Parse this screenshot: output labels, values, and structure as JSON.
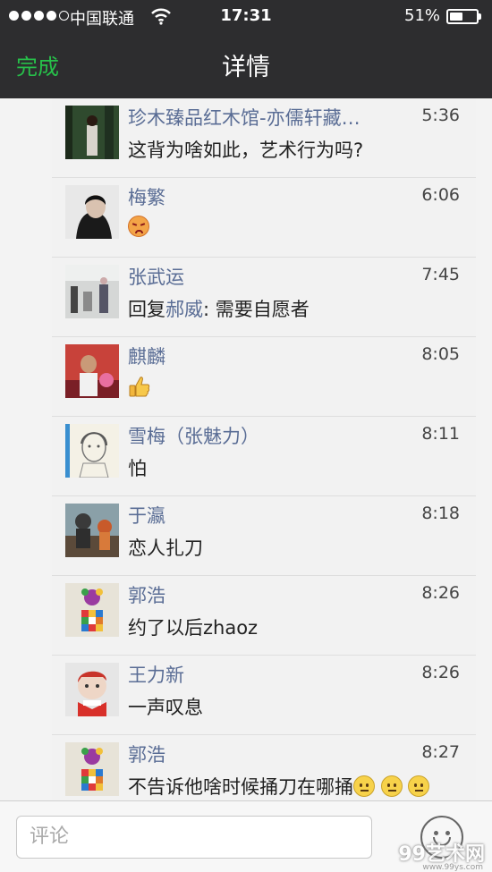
{
  "status": {
    "carrier": "中国联通",
    "time": "17:31",
    "battery_text": "51%",
    "battery_level": 0.51,
    "signal_bars": 4
  },
  "nav": {
    "done_label": "完成",
    "title": "详情"
  },
  "colors": {
    "nav_bg": "#2d2d2f",
    "done_green": "#27c04a",
    "name_blue": "#5a6d95"
  },
  "comments": [
    {
      "name": "珍木臻品红木馆-亦儒轩藏…",
      "time": "5:36",
      "text": "这背为啥如此，艺术行为吗?"
    },
    {
      "name": "梅繁",
      "time": "6:06",
      "emoji": "angry-face"
    },
    {
      "name": "张武运",
      "time": "7:45",
      "prefix": "回复",
      "reply_to": "郝威",
      "text": ": 需要自愿者"
    },
    {
      "name": "麒麟",
      "time": "8:05",
      "emoji": "thumbs-up"
    },
    {
      "name": "雪梅（张魅力）",
      "time": "8:11",
      "text": "怕"
    },
    {
      "name": "于瀛",
      "time": "8:18",
      "text": "恋人扎刀"
    },
    {
      "name": "郭浩",
      "time": "8:26",
      "text": "约了以后zhaoz"
    },
    {
      "name": "王力新",
      "time": "8:26",
      "text": "一声叹息"
    },
    {
      "name": "郭浩",
      "time": "8:27",
      "text": "不告诉他啥时候捅刀在哪捅"
    }
  ],
  "input": {
    "placeholder": "评论"
  },
  "watermark": {
    "text": "99艺术网",
    "sub": "www.99ys.com"
  }
}
